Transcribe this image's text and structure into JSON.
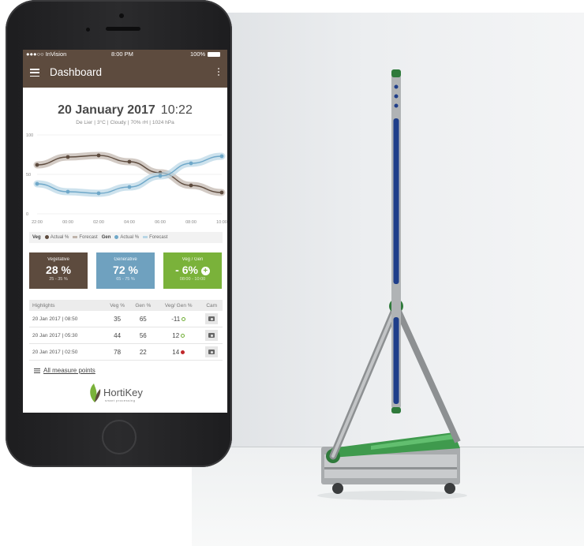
{
  "status_bar": {
    "carrier": "●●●○○ InVision",
    "time": "8:00 PM",
    "battery": "100%"
  },
  "app_bar": {
    "title": "Dashboard"
  },
  "header": {
    "date": "20 January 2017",
    "time": "10:22",
    "location": "De Lier",
    "temperature": "3°C",
    "condition": "Cloudy",
    "humidity": "70% rH",
    "pressure": "1024 hPa"
  },
  "chart_data": {
    "type": "line",
    "x": [
      "22:00",
      "00:00",
      "02:00",
      "04:00",
      "06:00",
      "08:00",
      "10:00"
    ],
    "ylim": [
      0,
      100
    ],
    "y_ticks": [
      "0",
      "50",
      "100"
    ],
    "series": [
      {
        "name": "Veg",
        "color": "#5d4b3e",
        "values": [
          62,
          72,
          74,
          66,
          52,
          36,
          27
        ]
      },
      {
        "name": "Gen",
        "color": "#6fa8c9",
        "values": [
          38,
          28,
          26,
          34,
          48,
          64,
          73
        ]
      }
    ],
    "legend": {
      "veg_label": "Veg",
      "gen_label": "Gen",
      "actual": "Actual %",
      "forecast": "Forecast"
    }
  },
  "tiles": [
    {
      "label": "Vegetative",
      "value": "28 %",
      "range": "25 - 35 %",
      "color": "#5d4b3e"
    },
    {
      "label": "Generative",
      "value": "72 %",
      "range": "65 - 75 %",
      "color": "#6fa1bf"
    },
    {
      "label": "Veg / Gen",
      "value": "- 6%",
      "range": "08:00 - 10:00",
      "color": "#7ab23a"
    }
  ],
  "highlights": {
    "headers": [
      "Highlights",
      "Veg %",
      "Gen %",
      "Veg/ Gen %",
      "Cam"
    ],
    "rows": [
      {
        "date": "20 Jan 2017 | 08:50",
        "veg": "35",
        "gen": "65",
        "diff": "-11",
        "status": "ok"
      },
      {
        "date": "20 Jan 2017 | 05:30",
        "veg": "44",
        "gen": "56",
        "diff": "12",
        "status": "ok"
      },
      {
        "date": "20 Jan 2017 | 02:50",
        "veg": "78",
        "gen": "22",
        "diff": "14",
        "status": "alert"
      }
    ]
  },
  "all_measure_points": "All measure points",
  "brand": {
    "name": "HortiKey",
    "tagline": "smart processing"
  }
}
